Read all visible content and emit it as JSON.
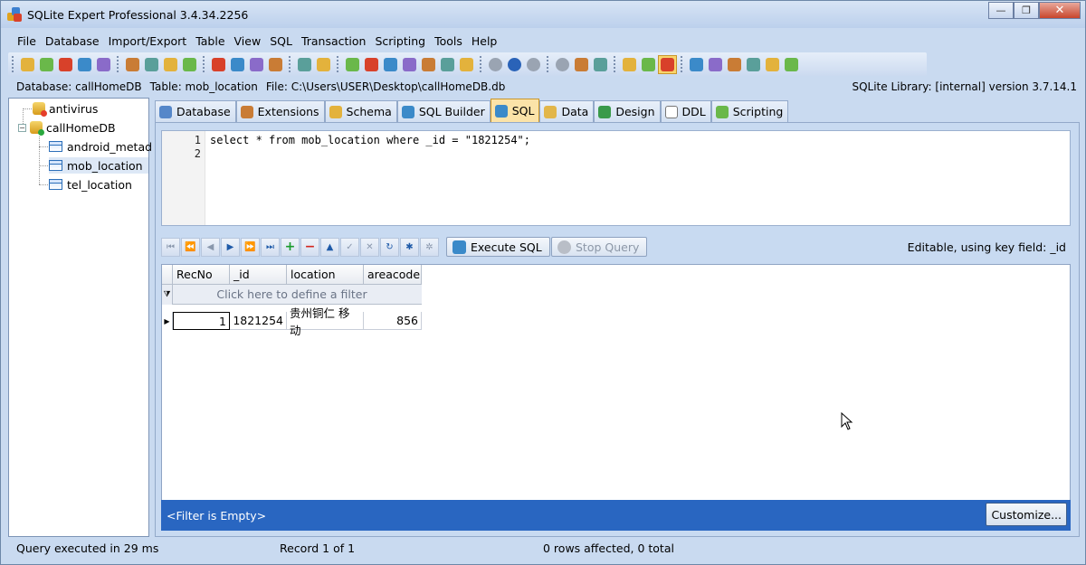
{
  "window": {
    "title": "SQLite Expert Professional 3.4.34.2256",
    "minimize_glyph": "—",
    "maximize_glyph": "❐",
    "close_glyph": "✕"
  },
  "menu": [
    "File",
    "Database",
    "Import/Export",
    "Table",
    "View",
    "SQL",
    "Transaction",
    "Scripting",
    "Tools",
    "Help"
  ],
  "toolbar_icons": [
    "new-db-icon",
    "add-db-icon",
    "remove-db-icon",
    "db-props-icon",
    "db-lock-icon",
    "new-table-icon",
    "import-icon",
    "export-icon",
    "db-tools-icon",
    "grid-icon",
    "text-icon",
    "refresh-icon",
    "table-props-icon",
    "run-icon",
    "copy-icon",
    "delete-icon",
    "sql-icon",
    "sql-open-icon",
    "sql-save-icon",
    "sql-run-icon",
    "sql-step-icon",
    "sql-stop-icon",
    "cancel-icon",
    "play-icon",
    "pause-icon",
    "stop-icon",
    "script-icon",
    "script-open-icon",
    "script-run-icon",
    "gear-icon",
    "filter-icon",
    "window-icon",
    "help-icon",
    "home-icon",
    "forum-icon",
    "edit-icon",
    "mail-icon",
    "update-icon",
    "key-icon"
  ],
  "info": {
    "database": "Database: callHomeDB",
    "table": "Table: mob_location",
    "file": "File: C:\\Users\\USER\\Desktop\\callHomeDB.db",
    "library": "SQLite Library: [internal] version 3.7.14.1"
  },
  "tree": {
    "root1": "antivirus",
    "root2": "callHomeDB",
    "children": [
      "android_metad",
      "mob_location",
      "tel_location"
    ],
    "expander": "−"
  },
  "tabs": [
    "Database",
    "Extensions",
    "Schema",
    "SQL Builder",
    "SQL",
    "Data",
    "Design",
    "DDL",
    "Scripting"
  ],
  "editor": {
    "line_numbers": [
      "1",
      "2"
    ],
    "line1": "select * from mob_location where _id = \"1821254\";"
  },
  "navigator": {
    "first": "⏮",
    "prior_page": "⏪",
    "prior": "◀",
    "next": "▶",
    "next_page": "⏩",
    "last": "⏭",
    "insert": "+",
    "delete": "−",
    "edit": "▲",
    "post": "✓",
    "cancel": "✕",
    "refresh": "↻",
    "apply_filter": "✱",
    "clear_filter": "✲"
  },
  "buttons": {
    "execute": "Execute SQL",
    "stop": "Stop Query"
  },
  "editable_status": "Editable, using key field: _id",
  "grid": {
    "columns": [
      "RecNo",
      "_id",
      "location",
      "areacode"
    ],
    "filter_hint": "Click here to define a filter",
    "funnel": "⧩",
    "row_indicator": "▶",
    "rows": [
      {
        "recno": "1",
        "id": "1821254",
        "location": "贵州铜仁 移动",
        "areacode": "856"
      }
    ]
  },
  "filter_bar": {
    "text": "<Filter is Empty>",
    "customize": "Customize..."
  },
  "status": {
    "query": "Query executed in 29 ms",
    "record": "Record 1 of 1",
    "affected": "0 rows affected, 0 total"
  },
  "colors": {
    "accent": "#2966c1",
    "active_tab": "#fbe3a8"
  }
}
